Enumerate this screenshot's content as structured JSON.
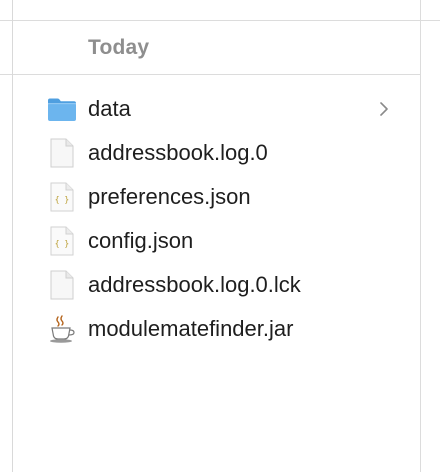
{
  "section": {
    "title": "Today"
  },
  "files": [
    {
      "name": "data",
      "icon": "folder-icon",
      "kind": "folder"
    },
    {
      "name": "addressbook.log.0",
      "icon": "document-icon",
      "kind": "file"
    },
    {
      "name": "preferences.json",
      "icon": "json-file-icon",
      "kind": "json"
    },
    {
      "name": "config.json",
      "icon": "json-file-icon",
      "kind": "json"
    },
    {
      "name": "addressbook.log.0.lck",
      "icon": "document-icon",
      "kind": "file"
    },
    {
      "name": "modulematefinder.jar",
      "icon": "java-cup-icon",
      "kind": "jar"
    }
  ],
  "colors": {
    "folder": "#5aa8e8",
    "header_text": "#8e8e8e",
    "text": "#1e1e1e",
    "divider": "#dcdcdc"
  }
}
